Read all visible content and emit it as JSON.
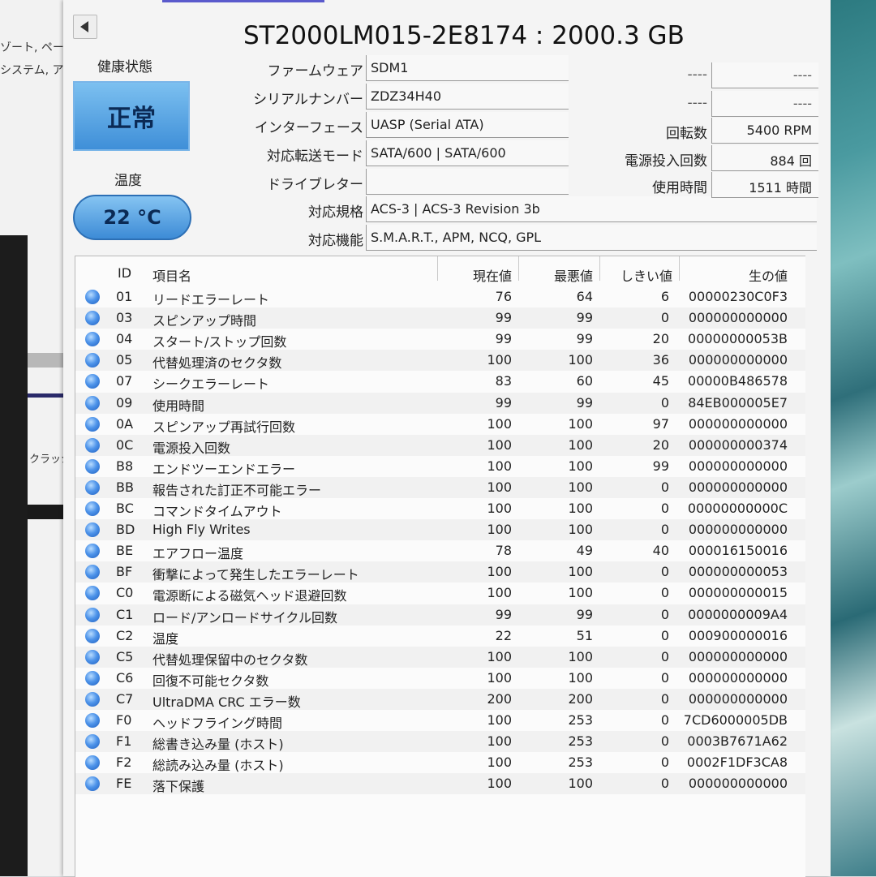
{
  "background_window": {
    "lines": [
      "ゾート, ペー",
      "システム, ア",
      "クラッシ"
    ]
  },
  "title": "ST2000LM015-2E8174 : 2000.3 GB",
  "health": {
    "label": "健康状態",
    "status": "正常",
    "color": "#3f8fd8"
  },
  "temperature": {
    "label": "温度",
    "value": "22 °C"
  },
  "info_left": [
    {
      "label": "ファームウェア",
      "value": "SDM1"
    },
    {
      "label": "シリアルナンバー",
      "value": "ZDZ34H40"
    },
    {
      "label": "インターフェース",
      "value": "UASP (Serial ATA)"
    },
    {
      "label": "対応転送モード",
      "value": "SATA/600 | SATA/600"
    },
    {
      "label": "ドライブレター",
      "value": ""
    },
    {
      "label": "対応規格",
      "value": "ACS-3 | ACS-3 Revision 3b"
    },
    {
      "label": "対応機能",
      "value": "S.M.A.R.T., APM, NCQ, GPL"
    }
  ],
  "info_right": [
    {
      "label": "----",
      "value": "----"
    },
    {
      "label": "----",
      "value": "----"
    },
    {
      "label": "回転数",
      "value": "5400 RPM"
    },
    {
      "label": "電源投入回数",
      "value": "884 回"
    },
    {
      "label": "使用時間",
      "value": "1511 時間"
    }
  ],
  "smart_table": {
    "headers": {
      "id": "ID",
      "name": "項目名",
      "current": "現在値",
      "worst": "最悪値",
      "threshold": "しきい値",
      "raw": "生の値"
    },
    "rows": [
      {
        "id": "01",
        "name": "リードエラーレート",
        "current": "76",
        "worst": "64",
        "threshold": "6",
        "raw": "00000230C0F3"
      },
      {
        "id": "03",
        "name": "スピンアップ時間",
        "current": "99",
        "worst": "99",
        "threshold": "0",
        "raw": "000000000000"
      },
      {
        "id": "04",
        "name": "スタート/ストップ回数",
        "current": "99",
        "worst": "99",
        "threshold": "20",
        "raw": "00000000053B"
      },
      {
        "id": "05",
        "name": "代替処理済のセクタ数",
        "current": "100",
        "worst": "100",
        "threshold": "36",
        "raw": "000000000000"
      },
      {
        "id": "07",
        "name": "シークエラーレート",
        "current": "83",
        "worst": "60",
        "threshold": "45",
        "raw": "00000B486578"
      },
      {
        "id": "09",
        "name": "使用時間",
        "current": "99",
        "worst": "99",
        "threshold": "0",
        "raw": "84EB000005E7"
      },
      {
        "id": "0A",
        "name": "スピンアップ再試行回数",
        "current": "100",
        "worst": "100",
        "threshold": "97",
        "raw": "000000000000"
      },
      {
        "id": "0C",
        "name": "電源投入回数",
        "current": "100",
        "worst": "100",
        "threshold": "20",
        "raw": "000000000374"
      },
      {
        "id": "B8",
        "name": "エンドツーエンドエラー",
        "current": "100",
        "worst": "100",
        "threshold": "99",
        "raw": "000000000000"
      },
      {
        "id": "BB",
        "name": "報告された訂正不可能エラー",
        "current": "100",
        "worst": "100",
        "threshold": "0",
        "raw": "000000000000"
      },
      {
        "id": "BC",
        "name": "コマンドタイムアウト",
        "current": "100",
        "worst": "100",
        "threshold": "0",
        "raw": "00000000000C"
      },
      {
        "id": "BD",
        "name": "High Fly Writes",
        "current": "100",
        "worst": "100",
        "threshold": "0",
        "raw": "000000000000"
      },
      {
        "id": "BE",
        "name": "エアフロー温度",
        "current": "78",
        "worst": "49",
        "threshold": "40",
        "raw": "000016150016"
      },
      {
        "id": "BF",
        "name": "衝撃によって発生したエラーレート",
        "current": "100",
        "worst": "100",
        "threshold": "0",
        "raw": "000000000053"
      },
      {
        "id": "C0",
        "name": "電源断による磁気ヘッド退避回数",
        "current": "100",
        "worst": "100",
        "threshold": "0",
        "raw": "000000000015"
      },
      {
        "id": "C1",
        "name": "ロード/アンロードサイクル回数",
        "current": "99",
        "worst": "99",
        "threshold": "0",
        "raw": "0000000009A4"
      },
      {
        "id": "C2",
        "name": "温度",
        "current": "22",
        "worst": "51",
        "threshold": "0",
        "raw": "000900000016"
      },
      {
        "id": "C5",
        "name": "代替処理保留中のセクタ数",
        "current": "100",
        "worst": "100",
        "threshold": "0",
        "raw": "000000000000"
      },
      {
        "id": "C6",
        "name": "回復不可能セクタ数",
        "current": "100",
        "worst": "100",
        "threshold": "0",
        "raw": "000000000000"
      },
      {
        "id": "C7",
        "name": "UltraDMA CRC エラー数",
        "current": "200",
        "worst": "200",
        "threshold": "0",
        "raw": "000000000000"
      },
      {
        "id": "F0",
        "name": "ヘッドフライング時間",
        "current": "100",
        "worst": "253",
        "threshold": "0",
        "raw": "7CD6000005DB"
      },
      {
        "id": "F1",
        "name": "総書き込み量 (ホスト)",
        "current": "100",
        "worst": "253",
        "threshold": "0",
        "raw": "0003B7671A62"
      },
      {
        "id": "F2",
        "name": "総読み込み量 (ホスト)",
        "current": "100",
        "worst": "253",
        "threshold": "0",
        "raw": "0002F1DF3CA8"
      },
      {
        "id": "FE",
        "name": "落下保護",
        "current": "100",
        "worst": "100",
        "threshold": "0",
        "raw": "000000000000"
      }
    ]
  }
}
